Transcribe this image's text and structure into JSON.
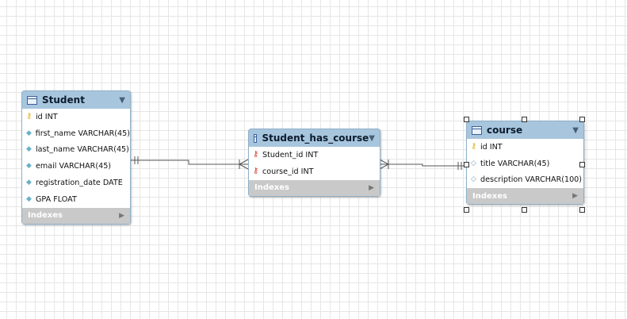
{
  "tables": {
    "student": {
      "title": "Student",
      "columns": [
        {
          "label": "id INT",
          "icon": "primary-key-icon"
        },
        {
          "label": "first_name VARCHAR(45)",
          "icon": "column-icon"
        },
        {
          "label": "last_name VARCHAR(45)",
          "icon": "column-icon"
        },
        {
          "label": "email VARCHAR(45)",
          "icon": "column-icon"
        },
        {
          "label": "registration_date DATE",
          "icon": "column-icon"
        },
        {
          "label": "GPA FLOAT",
          "icon": "column-icon"
        }
      ],
      "indexes_label": "Indexes"
    },
    "student_has_course": {
      "title": "Student_has_course",
      "columns": [
        {
          "label": "Student_id INT",
          "icon": "foreign-key-icon"
        },
        {
          "label": "course_id INT",
          "icon": "foreign-key-icon"
        }
      ],
      "indexes_label": "Indexes"
    },
    "course": {
      "title": "course",
      "columns": [
        {
          "label": "id INT",
          "icon": "primary-key-icon"
        },
        {
          "label": "title VARCHAR(45)",
          "icon": "nullable-column-icon"
        },
        {
          "label": "description VARCHAR(100)",
          "icon": "nullable-column-icon"
        }
      ],
      "indexes_label": "Indexes"
    }
  },
  "relationships": [
    {
      "from": "Student",
      "to": "Student_has_course",
      "from_end": "one-and-only-one",
      "to_end": "one-or-many"
    },
    {
      "from": "course",
      "to": "Student_has_course",
      "from_end": "one-and-only-one",
      "to_end": "one-or-many"
    }
  ],
  "selected_table": "course",
  "colors": {
    "header": "#a7c6de",
    "indexes_bar": "#c9c9c9",
    "primary_key": "#e0b020",
    "foreign_key": "#cc3a2e",
    "column_marker": "#6ab0c8",
    "relationship_line": "#555555"
  }
}
